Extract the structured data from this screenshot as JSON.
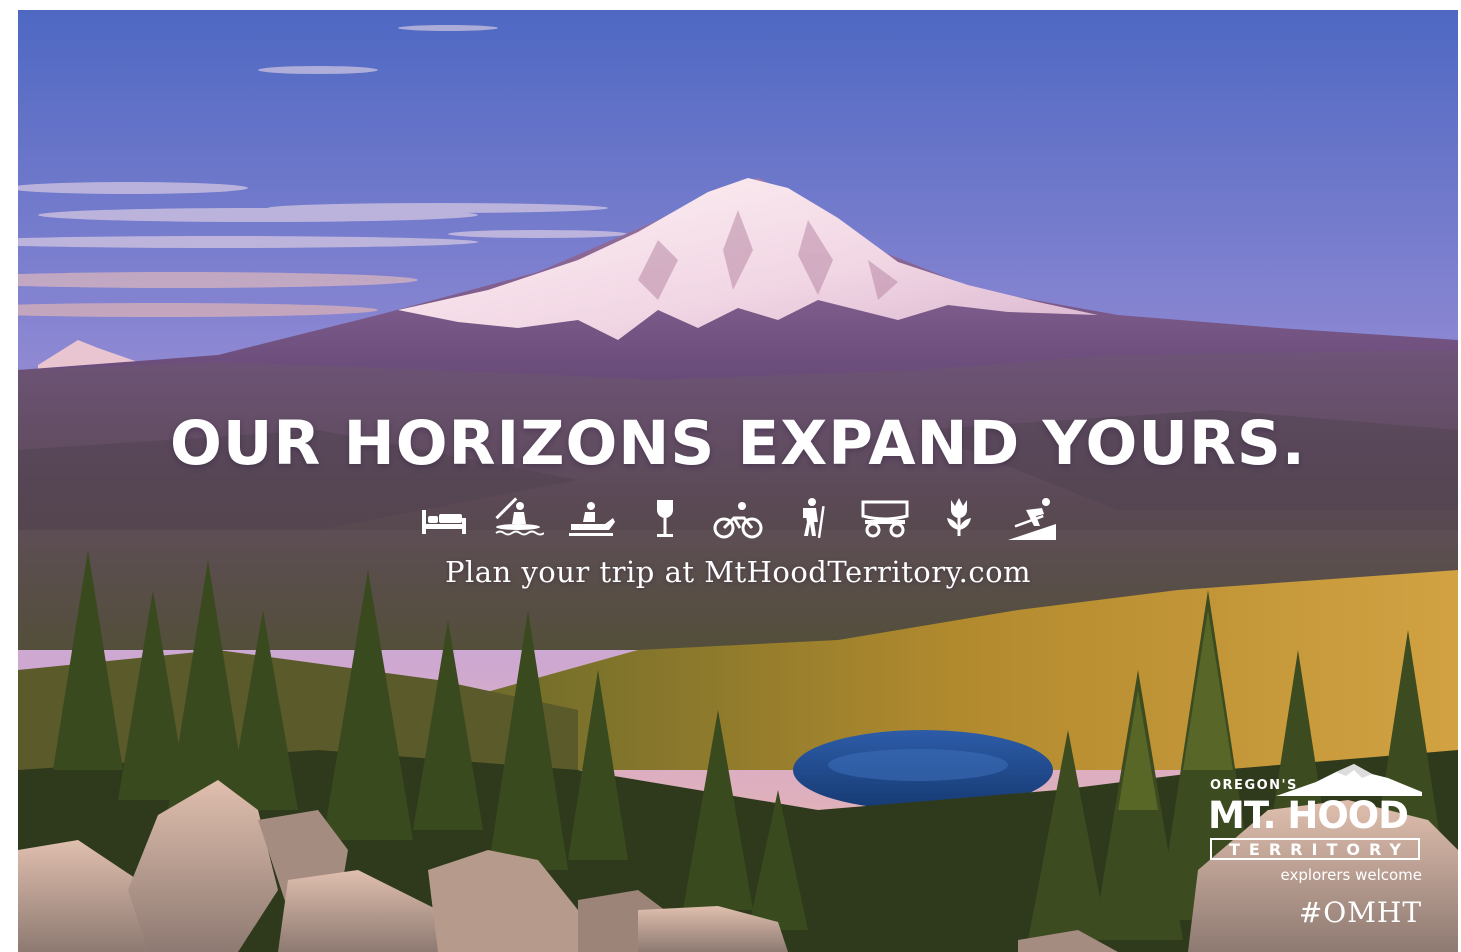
{
  "headline": "OUR HORIZONS EXPAND YOURS.",
  "tagline": "Plan your trip at MtHoodTerritory.com",
  "activity_icons": [
    "bed-icon",
    "kayak-icon",
    "snowmobile-icon",
    "wine-glass-icon",
    "bicycle-icon",
    "hiker-icon",
    "covered-wagon-icon",
    "tulip-icon",
    "skier-icon"
  ],
  "logo": {
    "top_line": "OREGON'S",
    "main": "MT. HOOD",
    "boxed": "TERRITORY",
    "subline": "explorers welcome"
  },
  "hashtag": "#OMHT",
  "colors": {
    "text": "#ffffff",
    "sky_top": "#5a6fc4",
    "sky_horizon": "#f1b7a8",
    "forest": "#4a5a20",
    "forest_lit": "#c99a3a",
    "lake": "#1e4a8a"
  }
}
